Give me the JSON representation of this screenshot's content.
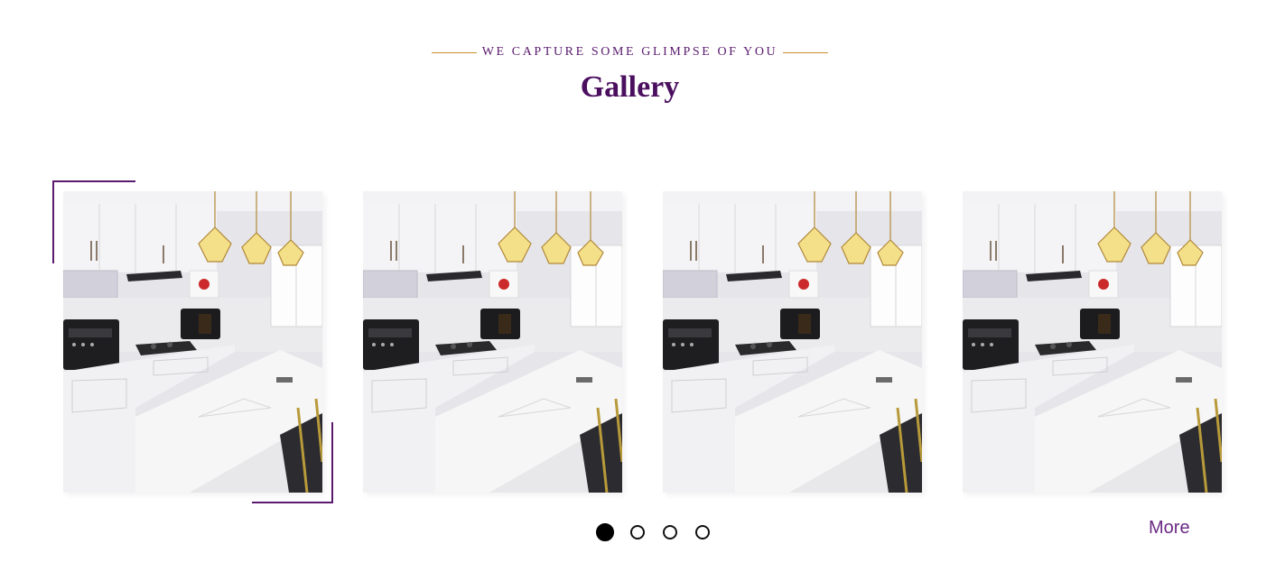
{
  "section": {
    "eyebrow": "WE CAPTURE SOME GLIMPSE OF YOU",
    "title": "Gallery"
  },
  "gallery": {
    "slides": [
      {
        "alt": "Kitchen interior"
      },
      {
        "alt": "Kitchen interior"
      },
      {
        "alt": "Kitchen interior"
      },
      {
        "alt": "Kitchen interior"
      }
    ],
    "pagination": {
      "count": 4,
      "active_index": 0
    },
    "more_label": "More"
  },
  "colors": {
    "accent_purple": "#4b0f5f",
    "gold_line": "#c8902e",
    "more_link": "#6a2a84"
  }
}
